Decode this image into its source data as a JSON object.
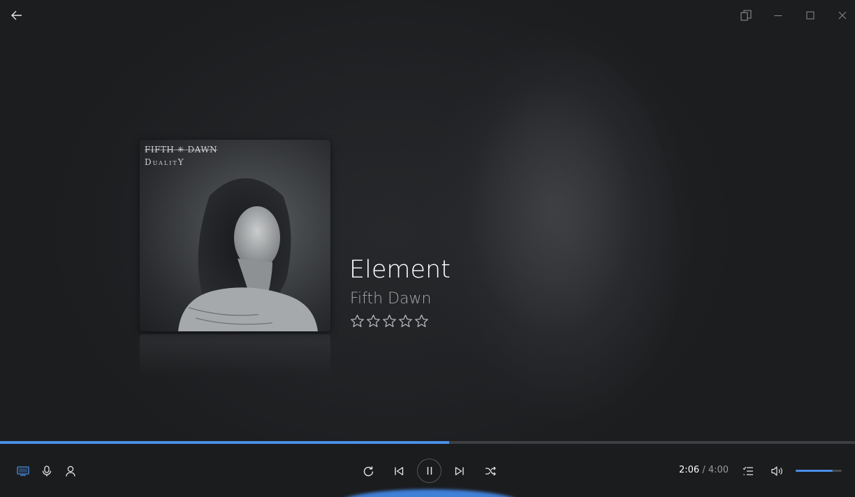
{
  "window": {
    "back_icon": "arrow-left-icon",
    "compact_icon": "compact-overlay-icon",
    "minimize_icon": "minimize-icon",
    "maximize_icon": "maximize-icon",
    "close_icon": "close-icon"
  },
  "album": {
    "band_text": "FIFTH ✳ DAWN",
    "title_text": "DualitY"
  },
  "track": {
    "title": "Element",
    "artist": "Fifth Dawn",
    "rating": 0,
    "rating_max": 5
  },
  "playback": {
    "current_time": "2:06",
    "separator": "/",
    "total_time": "4:00",
    "progress_fraction": 0.525,
    "volume_fraction": 0.8,
    "state": "playing"
  },
  "controls": {
    "left": [
      "now-playing-icon",
      "microphone-icon",
      "person-icon"
    ],
    "center": [
      "repeat-icon",
      "previous-icon",
      "pause-icon",
      "next-icon",
      "shuffle-icon"
    ],
    "right": [
      "queue-icon",
      "volume-icon"
    ]
  },
  "colors": {
    "accent": "#4a8fe7",
    "background": "#1e1f21",
    "text_primary": "#ffffff",
    "text_secondary": "#a7a8aa"
  }
}
